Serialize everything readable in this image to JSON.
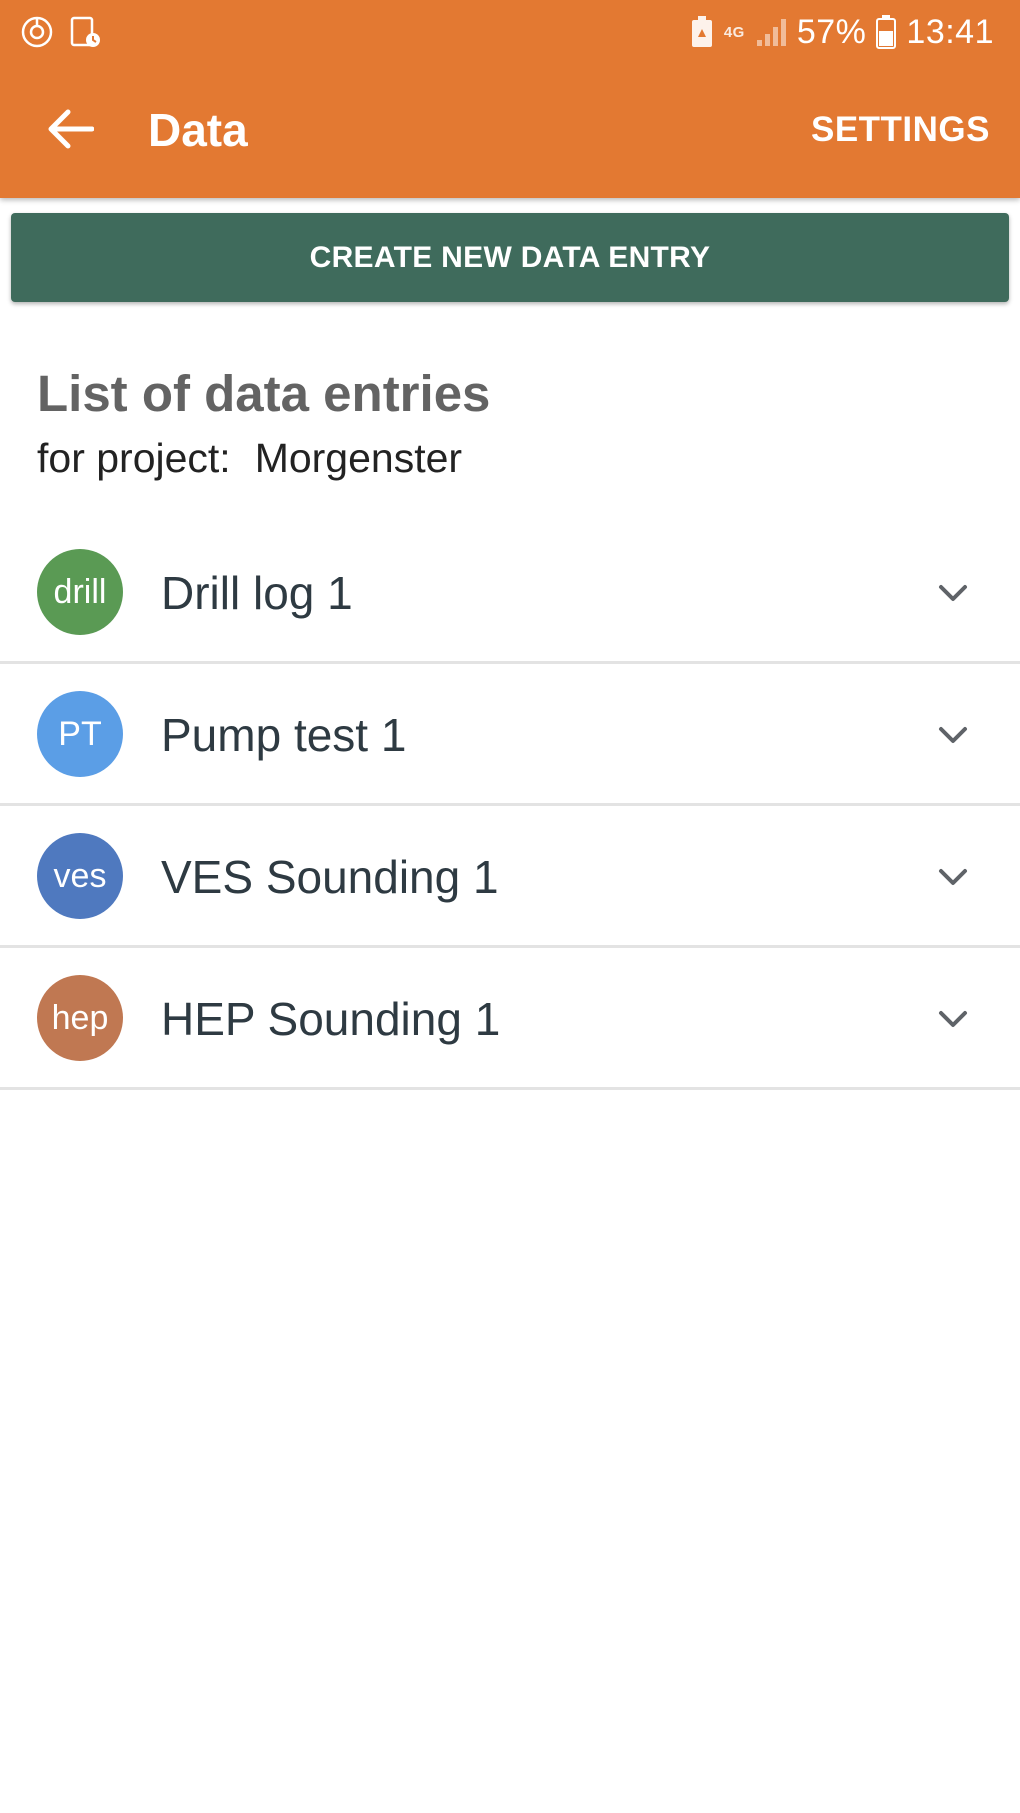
{
  "colors": {
    "header": "#E37932",
    "create_button": "#3F6B5C",
    "avatar_drill": "#5A9A54",
    "avatar_pt": "#5B9EE6",
    "avatar_ves": "#4F79BF",
    "avatar_hep": "#C07852"
  },
  "status_bar": {
    "left_icons": [
      "sync-icon",
      "screen-timeout-icon"
    ],
    "network": "4G",
    "battery_percent": "57%",
    "time": "13:41",
    "right_icons": [
      "battery-saver-icon",
      "signal-icon",
      "battery-icon"
    ]
  },
  "app_bar": {
    "back_icon": "arrow-left-icon",
    "title": "Data",
    "settings_label": "SETTINGS"
  },
  "create_button": {
    "label": "CREATE NEW DATA ENTRY"
  },
  "list": {
    "heading": "List of data entries",
    "project_prefix": "for project:",
    "project_name": "Morgenster",
    "entries": [
      {
        "avatar_text": "drill",
        "label": "Drill log 1",
        "color_key": "avatar_drill",
        "icon": "chevron-down-icon"
      },
      {
        "avatar_text": "PT",
        "label": "Pump test 1",
        "color_key": "avatar_pt",
        "icon": "chevron-down-icon"
      },
      {
        "avatar_text": "ves",
        "label": "VES Sounding 1",
        "color_key": "avatar_ves",
        "icon": "chevron-down-icon"
      },
      {
        "avatar_text": "hep",
        "label": "HEP Sounding 1",
        "color_key": "avatar_hep",
        "icon": "chevron-down-icon"
      }
    ]
  }
}
